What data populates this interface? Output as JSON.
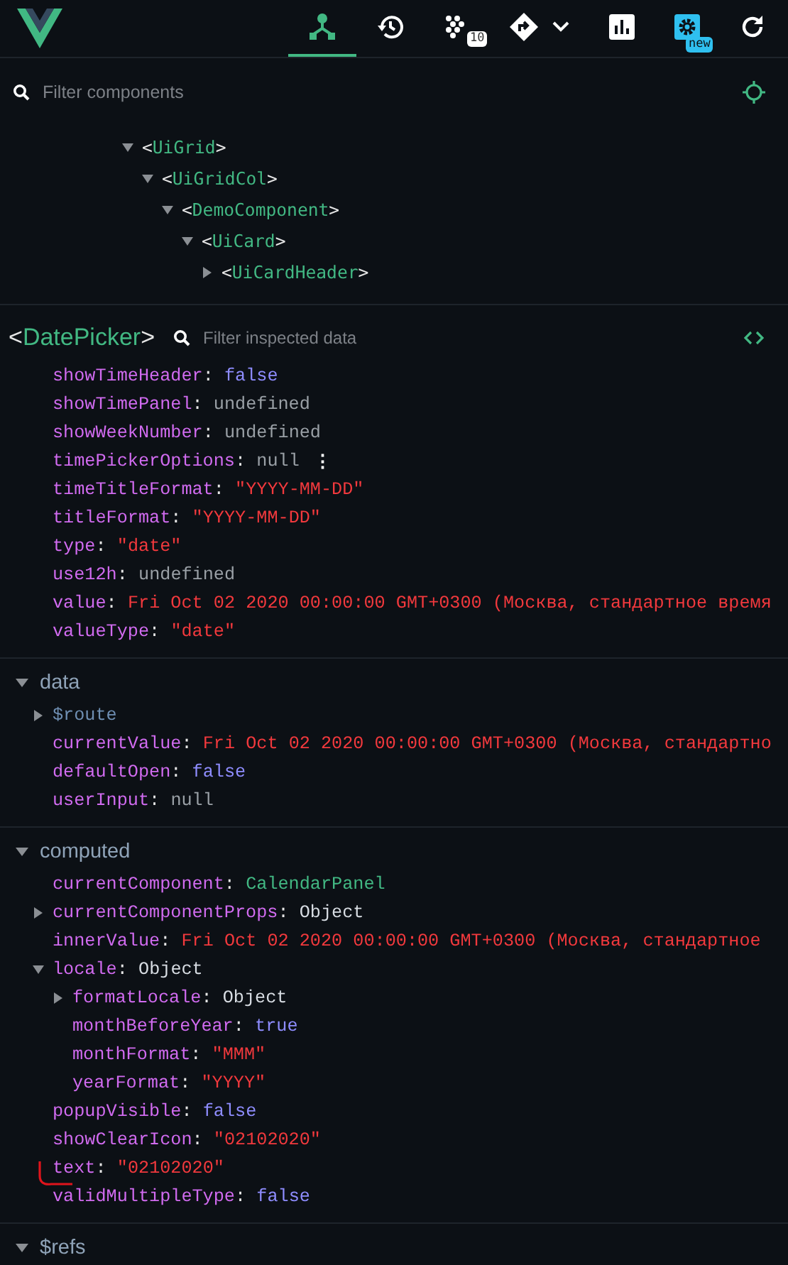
{
  "toolbar": {
    "tabs": [
      {
        "kind": "components",
        "selected": true
      },
      {
        "kind": "timeline",
        "selected": false
      },
      {
        "kind": "performance",
        "selected": false,
        "badge": "10"
      },
      {
        "kind": "routes",
        "selected": false
      },
      {
        "kind": "chart",
        "selected": false
      },
      {
        "kind": "settings",
        "selected": false,
        "badge": "new"
      },
      {
        "kind": "refresh",
        "selected": false
      }
    ]
  },
  "component_filter": {
    "placeholder": "Filter components"
  },
  "tree": [
    {
      "label": "<UiGrid>",
      "expanded": true,
      "children": [
        {
          "label": "<UiGridCol>",
          "expanded": true,
          "children": [
            {
              "label": "<DemoComponent>",
              "expanded": true,
              "children": [
                {
                  "label": "<UiCard>",
                  "expanded": true,
                  "children": [
                    {
                      "label": "<UiCardHeader>",
                      "expanded": false
                    }
                  ]
                }
              ]
            }
          ]
        }
      ]
    }
  ],
  "inspector": {
    "component": "<DatePicker>",
    "filter_placeholder": "Filter inspected data",
    "sections": [
      {
        "rows": [
          {
            "key": "showTimeHeader:",
            "value": "false",
            "kind": "boolean"
          },
          {
            "key": "showTimePanel:",
            "value": "undefined",
            "kind": "empty"
          },
          {
            "key": "showWeekNumber:",
            "value": "undefined",
            "kind": "empty"
          },
          {
            "key": "timePickerOptions:",
            "value": "null",
            "kind": "empty",
            "actions": "⋮"
          },
          {
            "key": "timeTitleFormat:",
            "value": "\"YYYY-MM-DD\"",
            "kind": "string"
          },
          {
            "key": "titleFormat:",
            "value": "\"YYYY-MM-DD\"",
            "kind": "string"
          },
          {
            "key": "type:",
            "value": "\"date\"",
            "kind": "string"
          },
          {
            "key": "use12h:",
            "value": "undefined",
            "kind": "empty"
          },
          {
            "key": "value:",
            "value": "Fri Oct 02 2020 00:00:00 GMT+0300 (Москва, стандартное время",
            "kind": "string"
          },
          {
            "key": "valueType:",
            "value": "\"date\"",
            "kind": "string"
          }
        ]
      },
      {
        "title": "data",
        "expanded": true,
        "rows": [
          {
            "key": "$route",
            "kind": "meta",
            "expanded": false
          },
          {
            "key": "currentValue:",
            "value": "Fri Oct 02 2020 00:00:00 GMT+0300 (Москва, стандартно",
            "kind": "string"
          },
          {
            "key": "defaultOpen:",
            "value": "false",
            "kind": "boolean"
          },
          {
            "key": "userInput:",
            "value": "null",
            "kind": "empty"
          }
        ]
      },
      {
        "title": "computed",
        "expanded": true,
        "rows": [
          {
            "key": "currentComponent:",
            "value": "CalendarPanel",
            "kind": "component"
          },
          {
            "key": "currentComponentProps:",
            "value": "Object",
            "kind": "object",
            "expanded": false
          },
          {
            "key": "innerValue:",
            "value": "Fri Oct 02 2020 00:00:00 GMT+0300 (Москва, стандартное",
            "kind": "string"
          },
          {
            "key": "locale:",
            "value": "Object",
            "kind": "object",
            "expanded": true,
            "children": [
              {
                "key": "formatLocale:",
                "value": "Object",
                "kind": "object",
                "expanded": false
              },
              {
                "key": "monthBeforeYear:",
                "value": "true",
                "kind": "boolean"
              },
              {
                "key": "monthFormat:",
                "value": "\"MMM\"",
                "kind": "string"
              },
              {
                "key": "yearFormat:",
                "value": "\"YYYY\"",
                "kind": "string"
              }
            ]
          },
          {
            "key": "popupVisible:",
            "value": "false",
            "kind": "boolean"
          },
          {
            "key": "showClearIcon:",
            "value": "\"02102020\"",
            "kind": "string"
          },
          {
            "key": "text:",
            "value": "\"02102020\"",
            "kind": "string",
            "marked": true
          },
          {
            "key": "validMultipleType:",
            "value": "false",
            "kind": "boolean"
          }
        ]
      },
      {
        "title": "$refs",
        "expanded": true
      }
    ]
  }
}
